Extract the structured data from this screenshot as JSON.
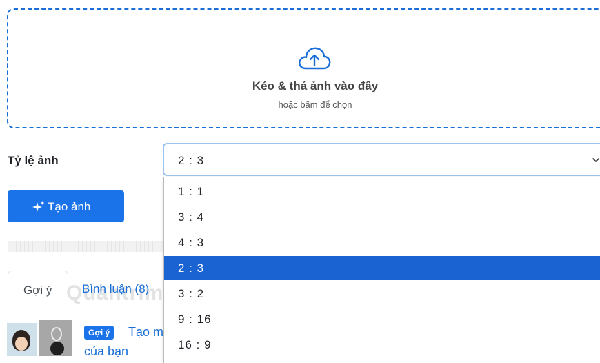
{
  "upload": {
    "title": "Kéo & thả ảnh vào đây",
    "subtitle": "hoặc bấm để chọn",
    "icon": "cloud-upload-icon"
  },
  "ratio": {
    "label": "Tỷ lệ ảnh",
    "selected": "2 : 3",
    "options": [
      "1 : 1",
      "3 : 4",
      "4 : 3",
      "2 : 3",
      "3 : 2",
      "9 : 16",
      "16 : 9"
    ]
  },
  "create_button": {
    "label": "Tạo ảnh",
    "icon": "sparkles-icon"
  },
  "tabs": [
    {
      "label": "Gợi ý",
      "active": true
    },
    {
      "label": "Bình luận (8)",
      "active": false
    }
  ],
  "suggestion": {
    "badge": "Gợi ý",
    "title_line1": "Tạo m",
    "title_line2": "của bạn"
  },
  "watermark": "Quantrimang",
  "colors": {
    "accent": "#1a73e8",
    "selected_option": "#1a63d2",
    "dropzone_border": "#1a6fd6"
  }
}
